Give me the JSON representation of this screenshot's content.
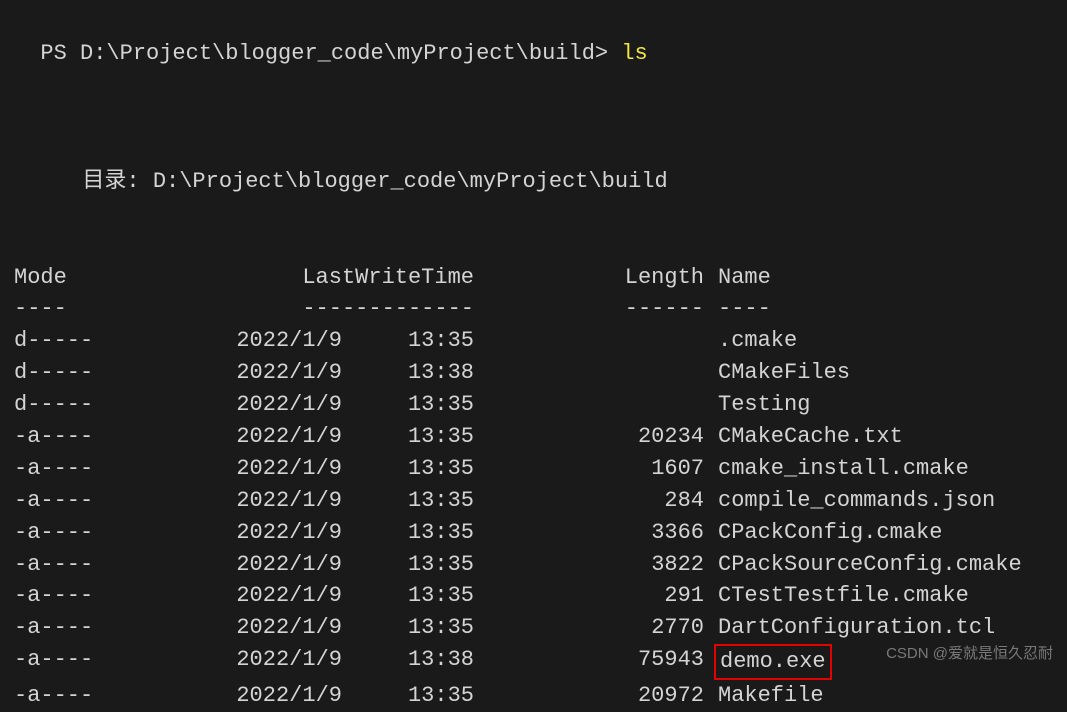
{
  "prompt": {
    "prefix": "PS ",
    "path": "D:\\Project\\blogger_code\\myProject\\build",
    "suffix": "> ",
    "command": "ls"
  },
  "directory": {
    "label": "目录: ",
    "path": "D:\\Project\\blogger_code\\myProject\\build"
  },
  "headers": {
    "mode": "Mode",
    "lastwrite": "LastWriteTime",
    "length": "Length",
    "name": "Name"
  },
  "dividers": {
    "mode": "----",
    "lastwrite": "-------------",
    "length": "------",
    "name": "----"
  },
  "rows": [
    {
      "mode": "d-----",
      "date": "2022/1/9",
      "time": "13:35",
      "length": "",
      "name": ".cmake",
      "highlight": false
    },
    {
      "mode": "d-----",
      "date": "2022/1/9",
      "time": "13:38",
      "length": "",
      "name": "CMakeFiles",
      "highlight": false
    },
    {
      "mode": "d-----",
      "date": "2022/1/9",
      "time": "13:35",
      "length": "",
      "name": "Testing",
      "highlight": false
    },
    {
      "mode": "-a----",
      "date": "2022/1/9",
      "time": "13:35",
      "length": "20234",
      "name": "CMakeCache.txt",
      "highlight": false
    },
    {
      "mode": "-a----",
      "date": "2022/1/9",
      "time": "13:35",
      "length": "1607",
      "name": "cmake_install.cmake",
      "highlight": false
    },
    {
      "mode": "-a----",
      "date": "2022/1/9",
      "time": "13:35",
      "length": "284",
      "name": "compile_commands.json",
      "highlight": false
    },
    {
      "mode": "-a----",
      "date": "2022/1/9",
      "time": "13:35",
      "length": "3366",
      "name": "CPackConfig.cmake",
      "highlight": false
    },
    {
      "mode": "-a----",
      "date": "2022/1/9",
      "time": "13:35",
      "length": "3822",
      "name": "CPackSourceConfig.cmake",
      "highlight": false
    },
    {
      "mode": "-a----",
      "date": "2022/1/9",
      "time": "13:35",
      "length": "291",
      "name": "CTestTestfile.cmake",
      "highlight": false
    },
    {
      "mode": "-a----",
      "date": "2022/1/9",
      "time": "13:35",
      "length": "2770",
      "name": "DartConfiguration.tcl",
      "highlight": false
    },
    {
      "mode": "-a----",
      "date": "2022/1/9",
      "time": "13:38",
      "length": "75943",
      "name": "demo.exe",
      "highlight": true
    },
    {
      "mode": "-a----",
      "date": "2022/1/9",
      "time": "13:35",
      "length": "20972",
      "name": "Makefile",
      "highlight": false
    }
  ],
  "watermark": "CSDN @爱就是恒久忍耐"
}
